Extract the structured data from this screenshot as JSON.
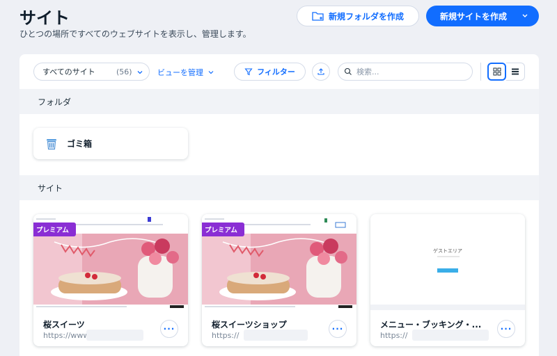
{
  "header": {
    "title": "サイト",
    "subtitle": "ひとつの場所ですべてのウェブサイトを表示し、管理します。",
    "new_folder_label": "新規フォルダを作成",
    "new_site_label": "新規サイトを作成"
  },
  "toolbar": {
    "view_select_label": "すべてのサイト",
    "view_select_count": "(56)",
    "manage_views_label": "ビューを管理",
    "filter_label": "フィルター",
    "search_placeholder": "検索..."
  },
  "sections": {
    "folders_label": "フォルダ",
    "sites_label": "サイト"
  },
  "folders": [
    {
      "name": "ゴミ箱"
    }
  ],
  "sites": [
    {
      "name": "桜スイーツ",
      "url": "https://www.",
      "badge": "プレミアム"
    },
    {
      "name": "桜スイーツショップ",
      "url": "https://",
      "badge": "プレミアム"
    },
    {
      "name": "メニュー・ブッキング・...",
      "url": "https://",
      "badge": "",
      "thumb_title": "ゲストエリア"
    }
  ],
  "colors": {
    "accent": "#116dff",
    "premium": "#8a2ed4",
    "background": "#eef0f5"
  }
}
